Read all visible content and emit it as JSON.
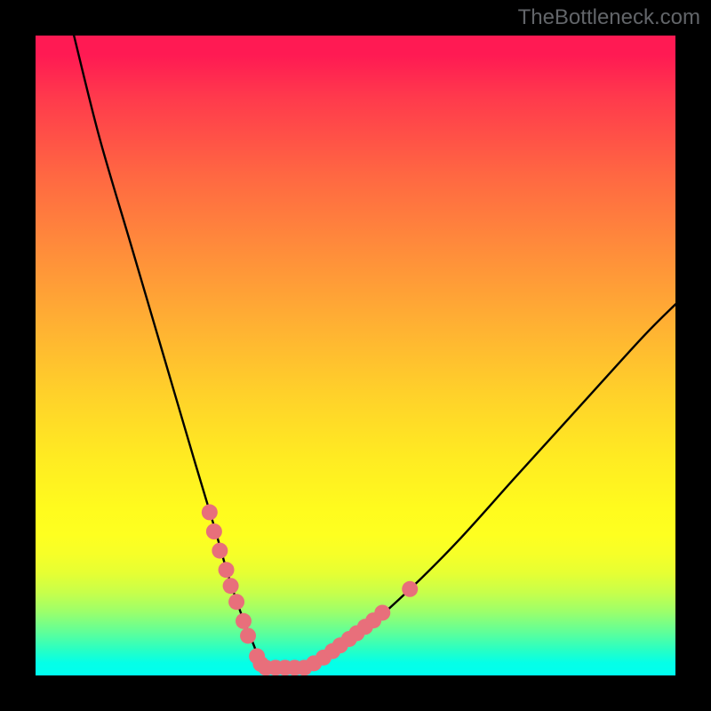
{
  "watermark": "TheBottleneck.com",
  "chart_data": {
    "type": "line",
    "title": "",
    "xlabel": "",
    "ylabel": "",
    "xlim": [
      0,
      100
    ],
    "ylim": [
      0,
      100
    ],
    "series": [
      {
        "name": "bottleneck-curve",
        "x": [
          6,
          10,
          15,
          20,
          25,
          28,
          30,
          32,
          34,
          35,
          36,
          38,
          40,
          44,
          50,
          58,
          66,
          75,
          85,
          95,
          100
        ],
        "values": [
          100,
          84,
          67,
          50,
          33,
          23,
          16,
          10,
          5,
          2.5,
          1.2,
          1.2,
          1.2,
          2.5,
          6,
          13,
          21,
          31,
          42,
          53,
          58
        ]
      }
    ],
    "markers": {
      "name": "scatter-dots",
      "color": "#e86f7b",
      "points": [
        {
          "x": 27.2,
          "y": 25.5
        },
        {
          "x": 27.9,
          "y": 22.5
        },
        {
          "x": 28.8,
          "y": 19.5
        },
        {
          "x": 29.8,
          "y": 16.5
        },
        {
          "x": 30.5,
          "y": 14.0
        },
        {
          "x": 31.4,
          "y": 11.5
        },
        {
          "x": 32.5,
          "y": 8.5
        },
        {
          "x": 33.2,
          "y": 6.2
        },
        {
          "x": 34.6,
          "y": 3.0
        },
        {
          "x": 35.2,
          "y": 1.8
        },
        {
          "x": 36.0,
          "y": 1.2
        },
        {
          "x": 37.5,
          "y": 1.2
        },
        {
          "x": 39.0,
          "y": 1.2
        },
        {
          "x": 40.5,
          "y": 1.2
        },
        {
          "x": 42.0,
          "y": 1.2
        },
        {
          "x": 43.5,
          "y": 1.9
        },
        {
          "x": 45.0,
          "y": 2.8
        },
        {
          "x": 46.4,
          "y": 3.8
        },
        {
          "x": 47.6,
          "y": 4.7
        },
        {
          "x": 49.0,
          "y": 5.7
        },
        {
          "x": 50.2,
          "y": 6.6
        },
        {
          "x": 51.5,
          "y": 7.6
        },
        {
          "x": 52.8,
          "y": 8.6
        },
        {
          "x": 54.2,
          "y": 9.8
        },
        {
          "x": 58.5,
          "y": 13.5
        }
      ]
    }
  }
}
